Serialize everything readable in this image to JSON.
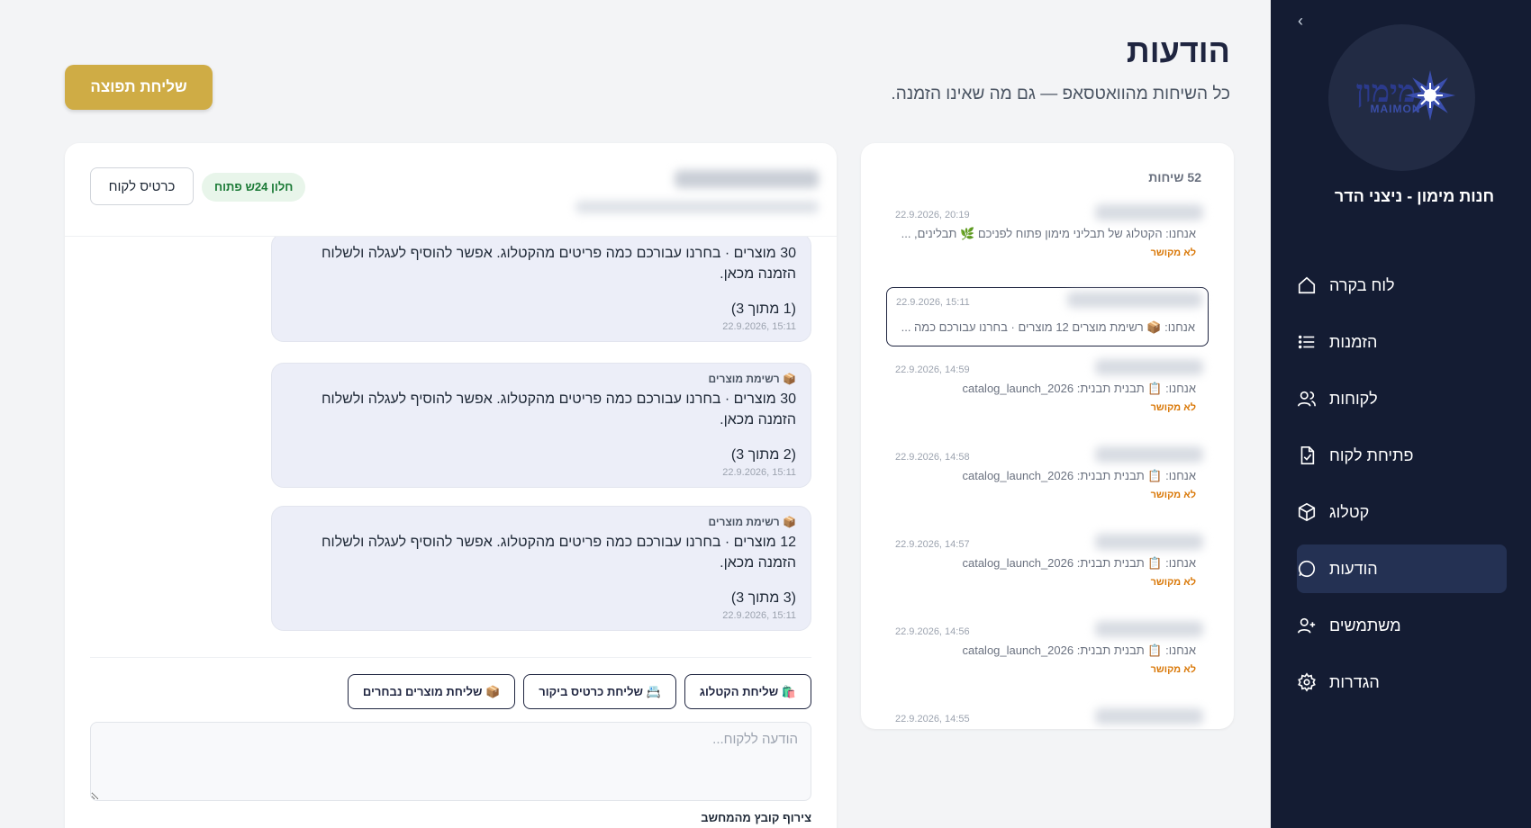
{
  "sidebar": {
    "collapse_icon": "chevron-left-icon",
    "logo": {
      "text_he": "מימון",
      "text_en": "MAIMON"
    },
    "shop_name": "חנות מימון - ניצני הדר",
    "items": [
      {
        "label": "לוח בקרה",
        "icon": "home-icon"
      },
      {
        "label": "הזמנות",
        "icon": "list-icon"
      },
      {
        "label": "לקוחות",
        "icon": "users-icon"
      },
      {
        "label": "פתיחת לקוח",
        "icon": "file-check-icon"
      },
      {
        "label": "קטלוג",
        "icon": "box-icon"
      },
      {
        "label": "הודעות",
        "icon": "message-icon",
        "active": true
      },
      {
        "label": "משתמשים",
        "icon": "user-plus-icon"
      },
      {
        "label": "הגדרות",
        "icon": "gear-icon"
      }
    ]
  },
  "header": {
    "title": "הודעות",
    "subtitle": "כל השיחות מהוואטסאפ — גם מה שאינו הזמנה.",
    "broadcast_label": "שליחת תפוצה"
  },
  "conversations": {
    "count_label": "52 שיחות",
    "items": [
      {
        "time": "22.9.2026, 20:19",
        "preview": "אנחנו: הקטלוג של תבליני מימון פתוח לפניכם 🌿 תבלינים, ...",
        "tag": "לא מקושר"
      },
      {
        "time": "22.9.2026, 15:11",
        "preview": "אנחנו: 📦 רשימת מוצרים 12 מוצרים · בחרנו עבורכם כמה ...",
        "tag": "",
        "selected": true
      },
      {
        "time": "22.9.2026, 14:59",
        "preview": "אנחנו: 📋 תבנית תבנית: catalog_launch_2026",
        "tag": "לא מקושר"
      },
      {
        "time": "22.9.2026, 14:58",
        "preview": "אנחנו: 📋 תבנית תבנית: catalog_launch_2026",
        "tag": "לא מקושר"
      },
      {
        "time": "22.9.2026, 14:57",
        "preview": "אנחנו: 📋 תבנית תבנית: catalog_launch_2026",
        "tag": "לא מקושר"
      },
      {
        "time": "22.9.2026, 14:56",
        "preview": "אנחנו: 📋 תבנית תבנית: catalog_launch_2026",
        "tag": "לא מקושר"
      },
      {
        "time": "22.9.2026, 14:55",
        "preview": "",
        "tag": ""
      }
    ]
  },
  "chat": {
    "window_badge": "חלון 24ש פתוח",
    "customer_card_label": "כרטיס לקוח",
    "messages": [
      {
        "label": "",
        "body": "30 מוצרים · בחרנו עבורכם כמה פריטים מהקטלוג. אפשר להוסיף לעגלה ולשלוח הזמנה מכאן.",
        "count": "(1 מתוך 3)",
        "time": "22.9.2026, 15:11"
      },
      {
        "label": "📦 רשימת מוצרים",
        "body": "30 מוצרים · בחרנו עבורכם כמה פריטים מהקטלוג. אפשר להוסיף לעגלה ולשלוח הזמנה מכאן.",
        "count": "(2 מתוך 3)",
        "time": "22.9.2026, 15:11"
      },
      {
        "label": "📦 רשימת מוצרים",
        "body": "12 מוצרים · בחרנו עבורכם כמה פריטים מהקטלוג. אפשר להוסיף לעגלה ולשלוח הזמנה מכאן.",
        "count": "(3 מתוך 3)",
        "time": "22.9.2026, 15:11"
      }
    ],
    "quick_actions": [
      "🛍️ שליחת הקטלוג",
      "📇 שליחת כרטיס ביקור",
      "📦 שליחת מוצרים נבחרים"
    ],
    "input_placeholder": "הודעה ללקוח...",
    "attach_label": "צירוף קובץ מהמחשב"
  },
  "colors": {
    "sidebar_bg": "#141c33",
    "sidebar_active": "#243153",
    "accent_gold": "#cfac45",
    "badge_green": "#1b7a36",
    "tag_orange": "#d97706",
    "bubble_bg": "#eceef8"
  }
}
